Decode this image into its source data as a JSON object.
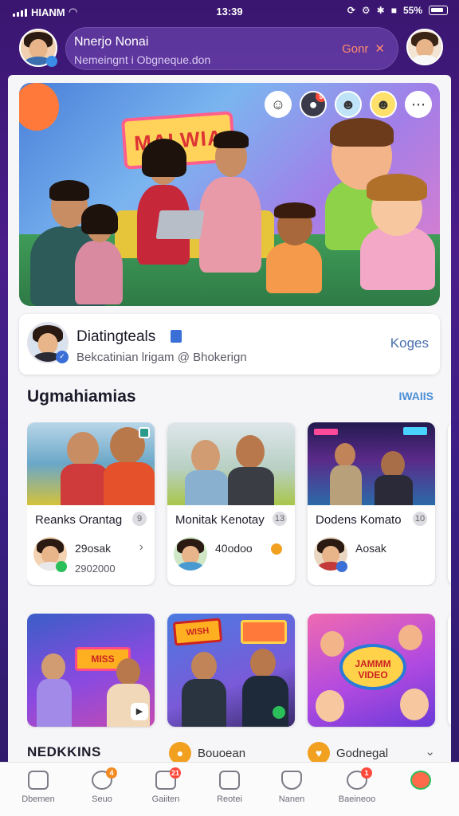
{
  "status_bar": {
    "carrier": "HIANM",
    "time": "13:39",
    "battery": "55%"
  },
  "top_bar": {
    "notification_title": "Nnerjo Nonai",
    "notification_subtitle": "Nemeingnt i Obgneque.don",
    "notification_action": "Gonr"
  },
  "hero": {
    "sign_text": "MALWIA",
    "badge_count": "9"
  },
  "profile_card": {
    "name": "Diatingteals",
    "subtitle": "Bekcatinian lrigam @ Bhokerign",
    "action": "Koges"
  },
  "section": {
    "title": "Ugmahiamias",
    "see_all": "IWAIIS"
  },
  "tiles": [
    {
      "title": "Reanks Orantag",
      "badge": "9",
      "line1": "29osak",
      "line2": "2902000"
    },
    {
      "title": "Monitak Kenotay",
      "badge": "13",
      "line1": "40odoo",
      "line2": ""
    },
    {
      "title": "Dodens Komato",
      "badge": "10",
      "line1": "Aosak",
      "line2": ""
    }
  ],
  "tiles_row2": [
    {
      "sign": "MISS"
    },
    {
      "sign": "WISH"
    },
    {
      "sign": "JAMMM VIDEO"
    }
  ],
  "bottom_strip": {
    "label": "NEDKKINS",
    "chip1": "Bouoean",
    "chip2": "Godnegal"
  },
  "nav": [
    {
      "label": "Dbemen",
      "badge": ""
    },
    {
      "label": "Seuo",
      "badge": "4"
    },
    {
      "label": "Gaiiten",
      "badge": "21"
    },
    {
      "label": "Reotei",
      "badge": ""
    },
    {
      "label": "Nanen",
      "badge": ""
    },
    {
      "label": "Baeineoo",
      "badge": "1"
    },
    {
      "label": "",
      "badge": ""
    }
  ],
  "colors": {
    "accent": "#4b8fd6",
    "brand_purple": "#4a1d8a",
    "notification_red": "#ff4a3b",
    "action_orange": "#ff8a6b"
  }
}
